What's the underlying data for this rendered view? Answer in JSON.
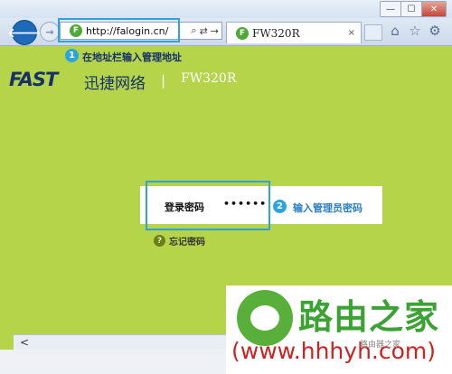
{
  "window": {
    "minimize": "—",
    "maximize": "☐",
    "close": "✕"
  },
  "toolbar": {
    "back_icon": "🡐",
    "forward_icon": "→",
    "address_url": "http://falogin.cn/",
    "favicon_letter": "F",
    "search_icon": "⌕",
    "refresh_icon": "⇄",
    "go_icon": "→"
  },
  "tab": {
    "title": "FW320R",
    "favicon_letter": "F",
    "close_icon": "×"
  },
  "tools_icons": {
    "home": "⌂",
    "favorites": "☆",
    "settings": "⚙"
  },
  "callouts": {
    "step1_num": "1",
    "step1_text": "在地址栏输入管理地址",
    "step2_num": "2",
    "step2_text": "输入管理员密码"
  },
  "header": {
    "logo": "FAST",
    "brand": "迅捷网络",
    "separator": "|",
    "model": "FW320R"
  },
  "login": {
    "label": "登录密码",
    "password_mask": "••••••"
  },
  "forgot": {
    "icon": "?",
    "text": "忘记密码"
  },
  "scrollbar": {
    "left_arrow": "<"
  },
  "watermark": {
    "text": "路由之家",
    "url": "(www.hhhyh.com)",
    "small": "路由器之家"
  }
}
